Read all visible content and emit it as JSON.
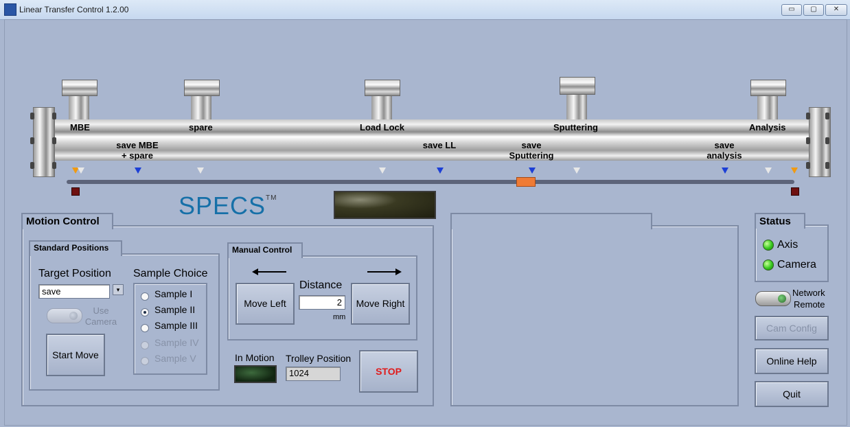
{
  "window": {
    "title": "Linear Transfer Control 1.2.00",
    "min_glyph": "▭",
    "max_glyph": "▢",
    "close_glyph": "✕"
  },
  "pipe": {
    "ports": [
      "MBE",
      "spare",
      "Load Lock",
      "Sputtering",
      "Analysis"
    ],
    "save_labels": [
      {
        "line1": "save MBE",
        "line2": "+ spare"
      },
      {
        "line1": "save LL",
        "line2": ""
      },
      {
        "line1": "save",
        "line2": "Sputtering"
      },
      {
        "line1": "save",
        "line2": "analysis"
      }
    ]
  },
  "logo": {
    "text": "SPECS",
    "tm": "TM"
  },
  "motion_control": {
    "title": "Motion Control",
    "standard_positions": {
      "title": "Standard Positions",
      "target_label": "Target Position",
      "target_value": "save",
      "use_camera": "Use Camera",
      "start_button": "Start Move",
      "sample_choice_label": "Sample Choice",
      "samples": [
        {
          "label": "Sample I",
          "selected": false,
          "enabled": true
        },
        {
          "label": "Sample II",
          "selected": true,
          "enabled": true
        },
        {
          "label": "Sample III",
          "selected": false,
          "enabled": true
        },
        {
          "label": "Sample IV",
          "selected": false,
          "enabled": false
        },
        {
          "label": "Sample V",
          "selected": false,
          "enabled": false
        }
      ]
    },
    "manual_control": {
      "title": "Manual Control",
      "move_left": "Move Left",
      "move_right": "Move Right",
      "distance_label": "Distance",
      "distance_value": "2",
      "unit": "mm"
    },
    "in_motion_label": "In Motion",
    "trolley_label": "Trolley Position",
    "trolley_value": "1024",
    "stop_button": "STOP"
  },
  "status": {
    "title": "Status",
    "axis": "Axis",
    "camera": "Camera",
    "network": "Network",
    "remote": "Remote",
    "cam_config": "Cam Config",
    "online_help": "Online Help",
    "quit": "Quit"
  },
  "colors": {
    "background": "#a9b6cf",
    "stop": "#e01b1b",
    "logo": "#1670a8",
    "marker_blue": "#1c3fd6",
    "trolley": "#ef7b35"
  }
}
